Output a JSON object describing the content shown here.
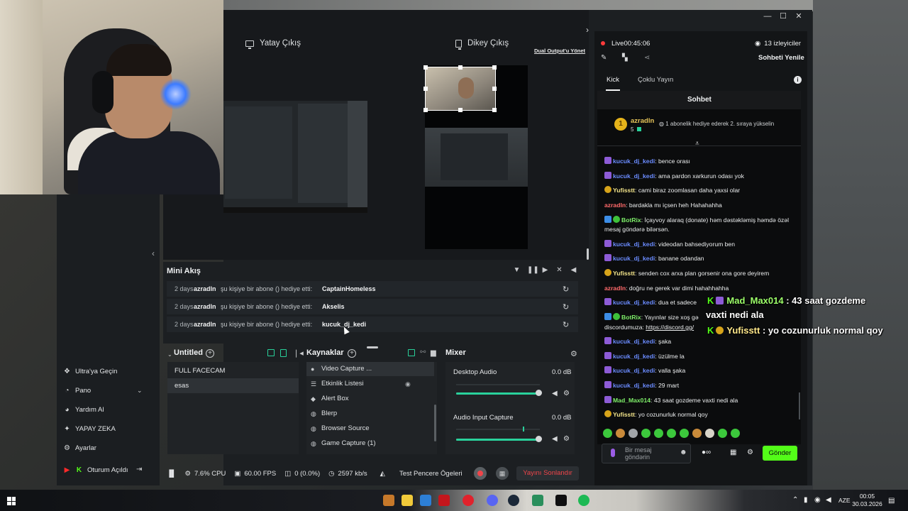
{
  "preview": {
    "horizontal_tab": "Yatay Çıkış",
    "vertical_tab": "Dikey Çıkış",
    "dual_output_link": "Dual Output'u Yönet"
  },
  "mini_feed": {
    "title": "Mini Akış",
    "rows": [
      {
        "age": "2 days",
        "user": "azradln",
        "action": "şu kişiye bir abone () hediye etti:",
        "target": "CaptainHomeless"
      },
      {
        "age": "2 days",
        "user": "azradln",
        "action": "şu kişiye bir abone () hediye etti:",
        "target": "Akselis"
      },
      {
        "age": "2 days",
        "user": "azradln",
        "action": "şu kişiye bir abone () hediye etti:",
        "target": "kucuk_dj_kedi"
      }
    ]
  },
  "scenes": {
    "title": "Untitled",
    "items": [
      "FULL FACECAM",
      "esas"
    ],
    "selected": "esas"
  },
  "sources": {
    "title": "Kaynaklar",
    "items": [
      {
        "label": "Video Capture ...",
        "icon": "camera-icon"
      },
      {
        "label": "Etkinlik Listesi",
        "icon": "list-icon"
      },
      {
        "label": "Alert Box",
        "icon": "bell-icon"
      },
      {
        "label": "Blerp",
        "icon": "globe-icon"
      },
      {
        "label": "Browser Source",
        "icon": "globe-icon"
      },
      {
        "label": "Game Capture (1)",
        "icon": "gamepad-icon"
      }
    ]
  },
  "mixer": {
    "title": "Mixer",
    "channels": [
      {
        "name": "Desktop Audio",
        "level": "0.0 dB",
        "volume": 1.0
      },
      {
        "name": "Audio Input Capture",
        "level": "0.0 dB",
        "volume": 1.0
      }
    ]
  },
  "nav": {
    "items": [
      "Ultra'ya Geçin",
      "Pano",
      "Yardım Al",
      "YAPAY ZEKA",
      "Ayarlar"
    ],
    "account": "Oturum Açıldı"
  },
  "status": {
    "cpu": "7.6% CPU",
    "fps": "60.00 FPS",
    "dropped": "0 (0.0%)",
    "bitrate": "2597 kb/s",
    "test_widgets": "Test Pencere Ögeleri",
    "end_stream": "Yayını Sonlandır"
  },
  "stream": {
    "live_label": "Live",
    "live_time": "00:45:06",
    "viewers": "13 izleyiciler",
    "refresh_chat": "Sohbeti Yenile",
    "tabs": [
      "Kick",
      "Çoklu Yayın"
    ],
    "active_tab": "Kick",
    "chat_title": "Sohbet"
  },
  "pinned": {
    "user": "azradln",
    "rank": "1",
    "sub_count": "5",
    "text": "1 abonelik hediye ederek 2. sıraya yükselin"
  },
  "chat": [
    {
      "user": "kucuk_dj_kedi",
      "text": "bence orası",
      "color": "blue",
      "badges": [
        "purple"
      ]
    },
    {
      "user": "kucuk_dj_kedi",
      "text": "ama pardon xarkurun odası yok",
      "color": "blue",
      "badges": [
        "purple"
      ]
    },
    {
      "user": "Yufisstt",
      "text": "cami biraz zoomlasan daha yaxsi olar",
      "color": "yellow",
      "badges": [
        "gold"
      ]
    },
    {
      "user": "azradln",
      "text": "bardakla mı içsen heh Hahahahha",
      "color": "pink",
      "badges": []
    },
    {
      "user": "BotRix",
      "text": "İçayvoy alaraq (donate) həm dəstəkləmiş həmdə özəl mesaj göndərə bilərsən.",
      "color": "green",
      "badges": [
        "blue",
        "green"
      ]
    },
    {
      "user": "kucuk_dj_kedi",
      "text": "videodan bahsediyorum ben",
      "color": "blue",
      "badges": [
        "purple"
      ]
    },
    {
      "user": "kucuk_dj_kedi",
      "text": "banane odandan",
      "color": "blue",
      "badges": [
        "purple"
      ]
    },
    {
      "user": "Yufisstt",
      "text": "senden cox arxa plan gorsenir ona gore deyirem",
      "color": "yellow",
      "badges": [
        "gold"
      ]
    },
    {
      "user": "azradln",
      "text": "doğru ne gerek var dimi hahahhahha",
      "color": "pink",
      "badges": []
    },
    {
      "user": "kucuk_dj_kedi",
      "text": "dua et sadece",
      "color": "blue",
      "badges": [
        "purple"
      ]
    },
    {
      "user": "BotRix",
      "text": "Yayınlar size xoş gə",
      "color": "green",
      "badges": [
        "blue",
        "green"
      ]
    },
    {
      "user": "",
      "text": "discordumuza:",
      "link": "https://discord.gg/",
      "color": "none",
      "badges": []
    },
    {
      "user": "kucuk_dj_kedi",
      "text": "şaka",
      "color": "blue",
      "badges": [
        "purple"
      ]
    },
    {
      "user": "kucuk_dj_kedi",
      "text": "üzülme la",
      "color": "blue",
      "badges": [
        "purple"
      ]
    },
    {
      "user": "kucuk_dj_kedi",
      "text": "valla şaka",
      "color": "blue",
      "badges": [
        "purple"
      ]
    },
    {
      "user": "kucuk_dj_kedi",
      "text": "29 mart",
      "color": "blue",
      "badges": [
        "purple"
      ]
    },
    {
      "user": "Mad_Max014",
      "text": "43 saat gozdeme vaxti nedi ala",
      "color": "green",
      "badges": [
        "purple"
      ]
    },
    {
      "user": "Yufisstt",
      "text": "yo cozunurluk normal qoy",
      "color": "yellow",
      "badges": [
        "gold"
      ]
    }
  ],
  "overlay_chat": [
    {
      "user": "Mad_Max014",
      "text": ": 43 saat gozdeme",
      "cont": "vaxti nedi ala"
    },
    {
      "user": "Yufisstt",
      "text": ": yo cozunurluk normal qoy"
    }
  ],
  "chat_input": {
    "placeholder": "Bir mesaj göndərin",
    "send_label": "Gönder"
  },
  "taskbar": {
    "language": "AZE",
    "time": "00:05",
    "date": "30.03.2026"
  },
  "colors": {
    "kick_green": "#53fc18",
    "live_red": "#ff3b3b",
    "end_stream_red": "#f0454a",
    "fader_teal": "#29d19b"
  }
}
